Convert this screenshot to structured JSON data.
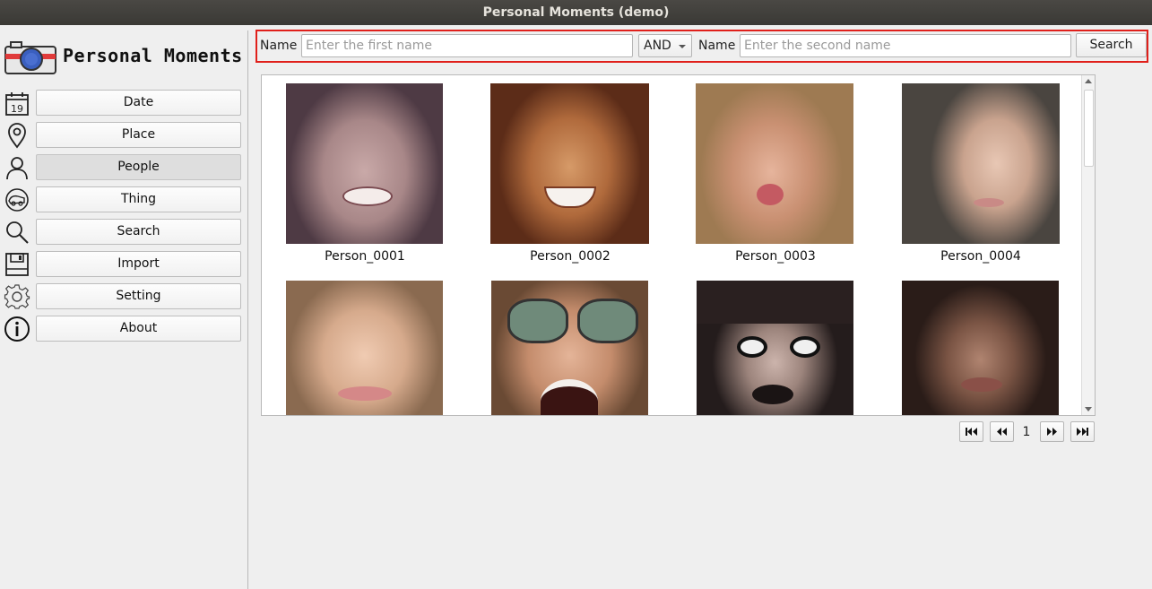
{
  "window": {
    "title": "Personal Moments (demo)"
  },
  "app": {
    "title": "Personal Moments"
  },
  "nav": {
    "items": [
      {
        "label": "Date",
        "icon": "calendar-icon"
      },
      {
        "label": "Place",
        "icon": "location-pin-icon"
      },
      {
        "label": "People",
        "icon": "person-icon",
        "active": true
      },
      {
        "label": "Thing",
        "icon": "thing-icon"
      },
      {
        "label": "Search",
        "icon": "search-icon"
      },
      {
        "label": "Import",
        "icon": "floppy-disk-icon"
      },
      {
        "label": "Setting",
        "icon": "gear-icon"
      },
      {
        "label": "About",
        "icon": "info-icon"
      }
    ],
    "calendar_day": "19"
  },
  "search": {
    "label1": "Name",
    "placeholder1": "Enter the first name",
    "value1": "",
    "operator": "AND",
    "label2": "Name",
    "placeholder2": "Enter the second name",
    "value2": "",
    "button": "Search"
  },
  "gallery": {
    "items": [
      {
        "name": "Person_0001"
      },
      {
        "name": "Person_0002"
      },
      {
        "name": "Person_0003"
      },
      {
        "name": "Person_0004"
      },
      {
        "name": ""
      },
      {
        "name": ""
      },
      {
        "name": ""
      },
      {
        "name": ""
      }
    ]
  },
  "pager": {
    "page": "1"
  },
  "colors": {
    "highlight_border": "#e0201b",
    "titlebar": "#3f3e3a"
  }
}
